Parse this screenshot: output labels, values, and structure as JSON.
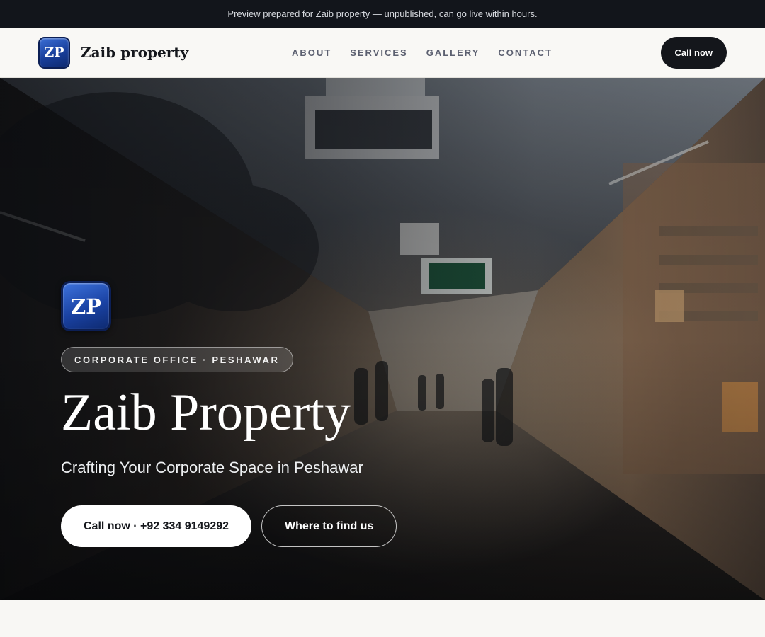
{
  "announcement": "Preview prepared for Zaib property — unpublished, can go live within hours.",
  "header": {
    "logo_text": "ZP",
    "brand_name": "Zaib property",
    "nav": [
      "ABOUT",
      "SERVICES",
      "GALLERY",
      "CONTACT"
    ],
    "cta_label": "Call now"
  },
  "hero": {
    "logo_text": "ZP",
    "tag": "CORPORATE OFFICE · PESHAWAR",
    "title": "Zaib Property",
    "subtitle": "Crafting Your Corporate Space in Peshawar",
    "primary_button": "Call now · +92 334 9149292",
    "secondary_button": "Where to find us",
    "background_image": "market-arcade-photo"
  },
  "colors": {
    "topbar": "#12151b",
    "logo_blue": "#1a42a3",
    "dark_button": "#14161b"
  }
}
